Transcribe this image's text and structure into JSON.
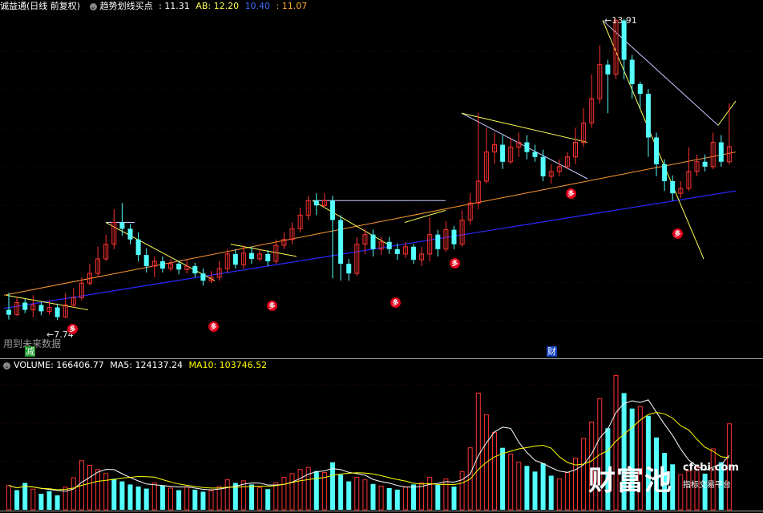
{
  "main_header": {
    "title": "诚益通(日线 前复权)",
    "indicator_name": "趋势划线买点",
    "colon_value": ": 11.31",
    "ab_label": "AB: 12.20",
    "blue_value": "10.40",
    "yellow_value": ": 11.07"
  },
  "volume_header": {
    "volume_label": "VOLUME: 166406.77",
    "ma5_label": "MA5: 124137.24",
    "ma10_label": "MA10: 103746.52"
  },
  "annotations": {
    "high_price": "13.91",
    "low_price": "7.74",
    "future_data_note": "用到未来数据",
    "reduce_marker": "减",
    "finance_marker": "财",
    "signal_badge": "多"
  },
  "watermark": {
    "brand_cn": "财富池",
    "brand_url": "cfcbi.com",
    "brand_sub": "指标交易平台"
  },
  "colors": {
    "up": "#ff3232",
    "down": "#54ffff",
    "ma5": "#ffffff",
    "ma10": "#ffff00",
    "trend_orange": "#ff9933",
    "trend_blue": "#2a2aff",
    "zigzag": "#ffff55",
    "upper_line": "#c8c8ff",
    "badge": "#e0001a"
  },
  "chart_data": {
    "type": "candlestick",
    "price_range_visible": [
      7.2,
      14.1
    ],
    "candles": [
      [
        7.95,
        7.85,
        8.3,
        7.75
      ],
      [
        7.85,
        8.1,
        8.22,
        7.82
      ],
      [
        8.1,
        7.95,
        8.18,
        7.88
      ],
      [
        7.95,
        8.05,
        8.25,
        7.8
      ],
      [
        8.05,
        7.92,
        8.1,
        7.84
      ],
      [
        7.92,
        8.0,
        8.15,
        7.85
      ],
      [
        8.0,
        7.8,
        8.08,
        7.74
      ],
      [
        7.8,
        8.05,
        8.3,
        7.78
      ],
      [
        8.05,
        8.2,
        8.4,
        8.0
      ],
      [
        8.2,
        8.5,
        8.62,
        8.15
      ],
      [
        8.5,
        8.7,
        8.9,
        8.45
      ],
      [
        8.7,
        9.0,
        9.25,
        8.62
      ],
      [
        9.0,
        9.3,
        9.5,
        8.95
      ],
      [
        9.3,
        9.75,
        10.02,
        9.2
      ],
      [
        9.75,
        9.62,
        10.15,
        9.48
      ],
      [
        9.62,
        9.4,
        9.72,
        9.3
      ],
      [
        9.4,
        9.08,
        9.55,
        8.95
      ],
      [
        9.08,
        8.85,
        9.22,
        8.72
      ],
      [
        8.85,
        8.95,
        9.05,
        8.62
      ],
      [
        8.95,
        8.8,
        9.05,
        8.72
      ],
      [
        8.8,
        8.9,
        9.0,
        8.75
      ],
      [
        8.9,
        8.78,
        8.95,
        8.68
      ],
      [
        8.78,
        8.85,
        8.98,
        8.7
      ],
      [
        8.85,
        8.7,
        8.92,
        8.62
      ],
      [
        8.7,
        8.55,
        8.8,
        8.45
      ],
      [
        8.55,
        8.62,
        8.75,
        8.5
      ],
      [
        8.62,
        8.8,
        8.95,
        8.55
      ],
      [
        8.8,
        9.1,
        9.2,
        8.72
      ],
      [
        9.1,
        8.88,
        9.2,
        8.8
      ],
      [
        8.88,
        9.12,
        9.28,
        8.8
      ],
      [
        9.12,
        9.0,
        9.25,
        8.9
      ],
      [
        9.0,
        9.1,
        9.2,
        8.95
      ],
      [
        9.1,
        8.95,
        9.18,
        8.85
      ],
      [
        8.95,
        9.28,
        9.4,
        8.9
      ],
      [
        9.28,
        9.4,
        9.55,
        9.2
      ],
      [
        9.4,
        9.62,
        9.75,
        9.3
      ],
      [
        9.62,
        9.9,
        10.05,
        9.55
      ],
      [
        9.9,
        10.2,
        10.3,
        9.8
      ],
      [
        10.2,
        10.1,
        10.35,
        9.9
      ],
      [
        10.1,
        10.2,
        10.35,
        10.05
      ],
      [
        10.2,
        9.8,
        10.3,
        8.6
      ],
      [
        9.8,
        8.9,
        9.9,
        8.55
      ],
      [
        8.9,
        8.7,
        9.0,
        8.55
      ],
      [
        8.7,
        9.3,
        9.45,
        8.65
      ],
      [
        9.3,
        9.5,
        9.62,
        9.1
      ],
      [
        9.5,
        9.2,
        9.6,
        9.05
      ],
      [
        9.2,
        9.35,
        9.45,
        9.08
      ],
      [
        9.35,
        9.2,
        9.45,
        9.1
      ],
      [
        9.2,
        9.1,
        9.32,
        8.98
      ],
      [
        9.1,
        9.25,
        9.35,
        9.02
      ],
      [
        9.25,
        8.98,
        9.3,
        8.9
      ],
      [
        8.98,
        9.1,
        9.25,
        8.85
      ],
      [
        9.1,
        9.5,
        9.85,
        8.95
      ],
      [
        9.5,
        9.2,
        9.6,
        9.05
      ],
      [
        9.2,
        9.6,
        9.78,
        9.15
      ],
      [
        9.6,
        9.3,
        9.68,
        9.2
      ],
      [
        9.3,
        9.8,
        10.0,
        9.25
      ],
      [
        9.8,
        10.15,
        10.35,
        9.7
      ],
      [
        10.15,
        10.6,
        12.0,
        10.02
      ],
      [
        10.6,
        11.2,
        11.7,
        10.55
      ],
      [
        11.2,
        11.35,
        11.6,
        10.95
      ],
      [
        11.35,
        11.0,
        11.55,
        10.85
      ],
      [
        11.0,
        11.3,
        11.5,
        10.95
      ],
      [
        11.3,
        11.4,
        11.6,
        11.1
      ],
      [
        11.4,
        11.2,
        11.55,
        11.05
      ],
      [
        11.2,
        11.1,
        11.35,
        11.0
      ],
      [
        11.1,
        10.7,
        11.25,
        10.6
      ],
      [
        10.7,
        10.8,
        10.95,
        10.55
      ],
      [
        10.8,
        10.9,
        11.05,
        10.7
      ],
      [
        10.9,
        11.1,
        11.2,
        10.85
      ],
      [
        11.1,
        11.4,
        11.7,
        10.95
      ],
      [
        11.4,
        11.8,
        12.1,
        11.3
      ],
      [
        11.8,
        12.3,
        12.8,
        11.7
      ],
      [
        12.3,
        13.0,
        13.4,
        12.2
      ],
      [
        13.0,
        12.8,
        13.1,
        12.0
      ],
      [
        12.8,
        13.91,
        13.95,
        12.7
      ],
      [
        13.91,
        13.1,
        13.95,
        12.7
      ],
      [
        13.1,
        12.6,
        13.2,
        12.3
      ],
      [
        12.6,
        12.4,
        12.65,
        12.1
      ],
      [
        12.4,
        11.5,
        12.5,
        11.1
      ],
      [
        11.5,
        10.95,
        11.6,
        10.7
      ],
      [
        10.95,
        10.6,
        11.05,
        10.4
      ],
      [
        10.6,
        10.35,
        10.72,
        10.2
      ],
      [
        10.35,
        10.45,
        10.6,
        10.25
      ],
      [
        10.45,
        10.8,
        11.3,
        10.4
      ],
      [
        10.8,
        11.0,
        11.15,
        10.7
      ],
      [
        11.0,
        10.9,
        11.15,
        10.8
      ],
      [
        10.9,
        11.4,
        11.6,
        10.85
      ],
      [
        11.4,
        11.0,
        11.55,
        10.9
      ],
      [
        11.0,
        11.31,
        12.2,
        10.95
      ]
    ],
    "volumes": [
      [
        47000,
        1
      ],
      [
        38000,
        0
      ],
      [
        52000,
        0
      ],
      [
        40000,
        1
      ],
      [
        31000,
        0
      ],
      [
        36000,
        0
      ],
      [
        28000,
        0
      ],
      [
        44000,
        1
      ],
      [
        62000,
        1
      ],
      [
        95000,
        1
      ],
      [
        86000,
        1
      ],
      [
        78000,
        1
      ],
      [
        70000,
        1
      ],
      [
        60000,
        0
      ],
      [
        55000,
        0
      ],
      [
        49000,
        0
      ],
      [
        45000,
        0
      ],
      [
        41000,
        0
      ],
      [
        52000,
        1
      ],
      [
        47000,
        0
      ],
      [
        42000,
        1
      ],
      [
        38000,
        0
      ],
      [
        44000,
        1
      ],
      [
        39000,
        0
      ],
      [
        35000,
        0
      ],
      [
        37000,
        1
      ],
      [
        45000,
        1
      ],
      [
        58000,
        1
      ],
      [
        52000,
        0
      ],
      [
        56000,
        1
      ],
      [
        49000,
        0
      ],
      [
        43000,
        1
      ],
      [
        40000,
        0
      ],
      [
        52000,
        1
      ],
      [
        63000,
        1
      ],
      [
        70000,
        1
      ],
      [
        78000,
        1
      ],
      [
        82000,
        1
      ],
      [
        75000,
        0
      ],
      [
        72000,
        1
      ],
      [
        92000,
        0
      ],
      [
        68000,
        0
      ],
      [
        55000,
        0
      ],
      [
        63000,
        1
      ],
      [
        58000,
        1
      ],
      [
        50000,
        0
      ],
      [
        46000,
        1
      ],
      [
        42000,
        0
      ],
      [
        39000,
        0
      ],
      [
        44000,
        1
      ],
      [
        49000,
        0
      ],
      [
        52000,
        1
      ],
      [
        63000,
        1
      ],
      [
        48000,
        0
      ],
      [
        60000,
        1
      ],
      [
        45000,
        0
      ],
      [
        74000,
        1
      ],
      [
        120000,
        1
      ],
      [
        226000,
        1
      ],
      [
        184000,
        1
      ],
      [
        150000,
        1
      ],
      [
        120000,
        0
      ],
      [
        108000,
        1
      ],
      [
        92000,
        1
      ],
      [
        85000,
        0
      ],
      [
        74000,
        0
      ],
      [
        90000,
        0
      ],
      [
        66000,
        0
      ],
      [
        60000,
        1
      ],
      [
        72000,
        1
      ],
      [
        100000,
        1
      ],
      [
        138000,
        1
      ],
      [
        170000,
        1
      ],
      [
        215000,
        1
      ],
      [
        158000,
        0
      ],
      [
        260000,
        1
      ],
      [
        226000,
        0
      ],
      [
        196000,
        0
      ],
      [
        200000,
        1
      ],
      [
        182000,
        0
      ],
      [
        140000,
        0
      ],
      [
        110000,
        0
      ],
      [
        88000,
        0
      ],
      [
        68000,
        1
      ],
      [
        75000,
        1
      ],
      [
        82000,
        1
      ],
      [
        70000,
        0
      ],
      [
        118000,
        1
      ],
      [
        92000,
        0
      ],
      [
        166406,
        1
      ]
    ],
    "ma5_last": 124137.24,
    "ma10_last": 103746.52,
    "high_label": 13.91,
    "low_label": 7.74
  }
}
